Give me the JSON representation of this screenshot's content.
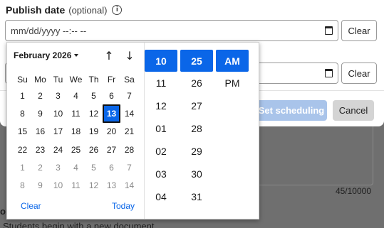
{
  "background": {
    "counter": "45/10000",
    "cut_label": "on",
    "cut_text": "Students begin with a new document"
  },
  "modal": {
    "label": "Publish date",
    "label_optional": "(optional)",
    "info_icon": "info-icon",
    "publish_input_placeholder": "mm/dd/yyyy --:-- --",
    "clear_label": "Clear",
    "clear_label_2": "Clear",
    "set_scheduling_label": "Set scheduling",
    "cancel_label": "Cancel",
    "accent_color": "#0a66e8"
  },
  "picker": {
    "month_label": "February 2026",
    "nav_up_icon": "↑",
    "nav_down_icon": "↓",
    "weekdays": [
      "Su",
      "Mo",
      "Tu",
      "We",
      "Th",
      "Fr",
      "Sa"
    ],
    "days": [
      {
        "d": "1",
        "m": false
      },
      {
        "d": "2",
        "m": false
      },
      {
        "d": "3",
        "m": false
      },
      {
        "d": "4",
        "m": false
      },
      {
        "d": "5",
        "m": false
      },
      {
        "d": "6",
        "m": false
      },
      {
        "d": "7",
        "m": false
      },
      {
        "d": "8",
        "m": false
      },
      {
        "d": "9",
        "m": false
      },
      {
        "d": "10",
        "m": false
      },
      {
        "d": "11",
        "m": false
      },
      {
        "d": "12",
        "m": false
      },
      {
        "d": "13",
        "m": false,
        "sel": true
      },
      {
        "d": "14",
        "m": false
      },
      {
        "d": "15",
        "m": false
      },
      {
        "d": "16",
        "m": false
      },
      {
        "d": "17",
        "m": false
      },
      {
        "d": "18",
        "m": false
      },
      {
        "d": "19",
        "m": false
      },
      {
        "d": "20",
        "m": false
      },
      {
        "d": "21",
        "m": false
      },
      {
        "d": "22",
        "m": false
      },
      {
        "d": "23",
        "m": false
      },
      {
        "d": "24",
        "m": false
      },
      {
        "d": "25",
        "m": false
      },
      {
        "d": "26",
        "m": false
      },
      {
        "d": "27",
        "m": false
      },
      {
        "d": "28",
        "m": false
      },
      {
        "d": "1",
        "m": true
      },
      {
        "d": "2",
        "m": true
      },
      {
        "d": "3",
        "m": true
      },
      {
        "d": "4",
        "m": true
      },
      {
        "d": "5",
        "m": true
      },
      {
        "d": "6",
        "m": true
      },
      {
        "d": "7",
        "m": true
      },
      {
        "d": "8",
        "m": true
      },
      {
        "d": "9",
        "m": true
      },
      {
        "d": "10",
        "m": true
      },
      {
        "d": "11",
        "m": true
      },
      {
        "d": "12",
        "m": true
      },
      {
        "d": "13",
        "m": true
      },
      {
        "d": "14",
        "m": true
      }
    ],
    "clear_label": "Clear",
    "today_label": "Today",
    "hours": [
      "10",
      "11",
      "12",
      "01",
      "02",
      "03",
      "04"
    ],
    "selected_hour": "10",
    "minutes": [
      "25",
      "26",
      "27",
      "28",
      "29",
      "30",
      "31"
    ],
    "selected_minute": "25",
    "periods": [
      "AM",
      "PM"
    ],
    "selected_period": "AM"
  }
}
